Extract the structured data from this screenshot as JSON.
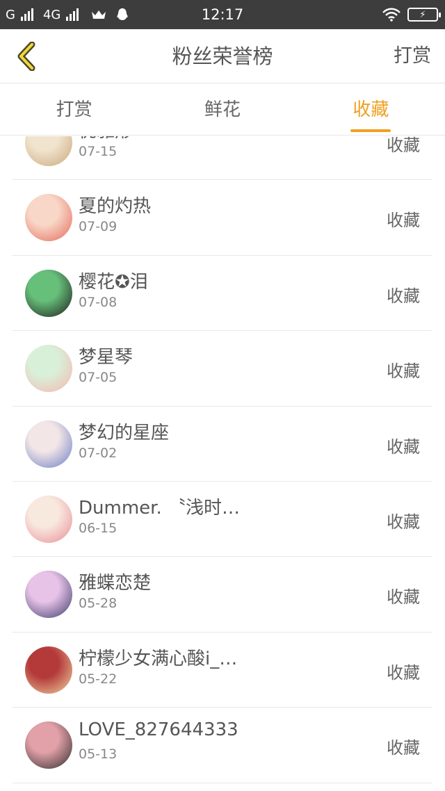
{
  "status_bar": {
    "carrier1": "G",
    "carrier2": "4G",
    "time": "12:17",
    "icons": [
      "signal-icon",
      "crown-icon",
      "qq-icon",
      "wifi-icon",
      "battery-charging-icon"
    ]
  },
  "header": {
    "title": "粉丝荣誉榜",
    "action": "打赏",
    "back_icon": "chevron-left-icon",
    "accent_color": "#f0a020"
  },
  "tabs": [
    {
      "label": "打赏",
      "active": false
    },
    {
      "label": "鲜花",
      "active": false
    },
    {
      "label": "收藏",
      "active": true
    }
  ],
  "fans": [
    {
      "name": "优雅形",
      "date": "07-15",
      "action": "收藏",
      "avatar_colors": [
        "#c9a77a",
        "#f1e4cf"
      ]
    },
    {
      "name": "夏的灼热",
      "date": "07-09",
      "action": "收藏",
      "avatar_colors": [
        "#e46a5a",
        "#f8d7c8"
      ]
    },
    {
      "name": "樱花✪泪",
      "date": "07-08",
      "action": "收藏",
      "avatar_colors": [
        "#1b1b1b",
        "#67c07a"
      ]
    },
    {
      "name": "梦星琴",
      "date": "07-05",
      "action": "收藏",
      "avatar_colors": [
        "#f4b6b0",
        "#d9f0d8"
      ]
    },
    {
      "name": "梦幻的星座",
      "date": "07-02",
      "action": "收藏",
      "avatar_colors": [
        "#6b7cc6",
        "#f2e6e6"
      ]
    },
    {
      "name": "Dummer. 〝浅时…",
      "date": "06-15",
      "action": "收藏",
      "avatar_colors": [
        "#e98c96",
        "#f8e9df"
      ]
    },
    {
      "name": "雅蝶恋楚",
      "date": "05-28",
      "action": "收藏",
      "avatar_colors": [
        "#3a3a6a",
        "#e8c3e8"
      ]
    },
    {
      "name": "柠檬少女满心酸i_…",
      "date": "05-22",
      "action": "收藏",
      "avatar_colors": [
        "#f0d7a4",
        "#b43a3a"
      ]
    },
    {
      "name": "LOVE_827644333",
      "date": "05-13",
      "action": "收藏",
      "avatar_colors": [
        "#2b2b2b",
        "#e2a0a8"
      ]
    }
  ]
}
